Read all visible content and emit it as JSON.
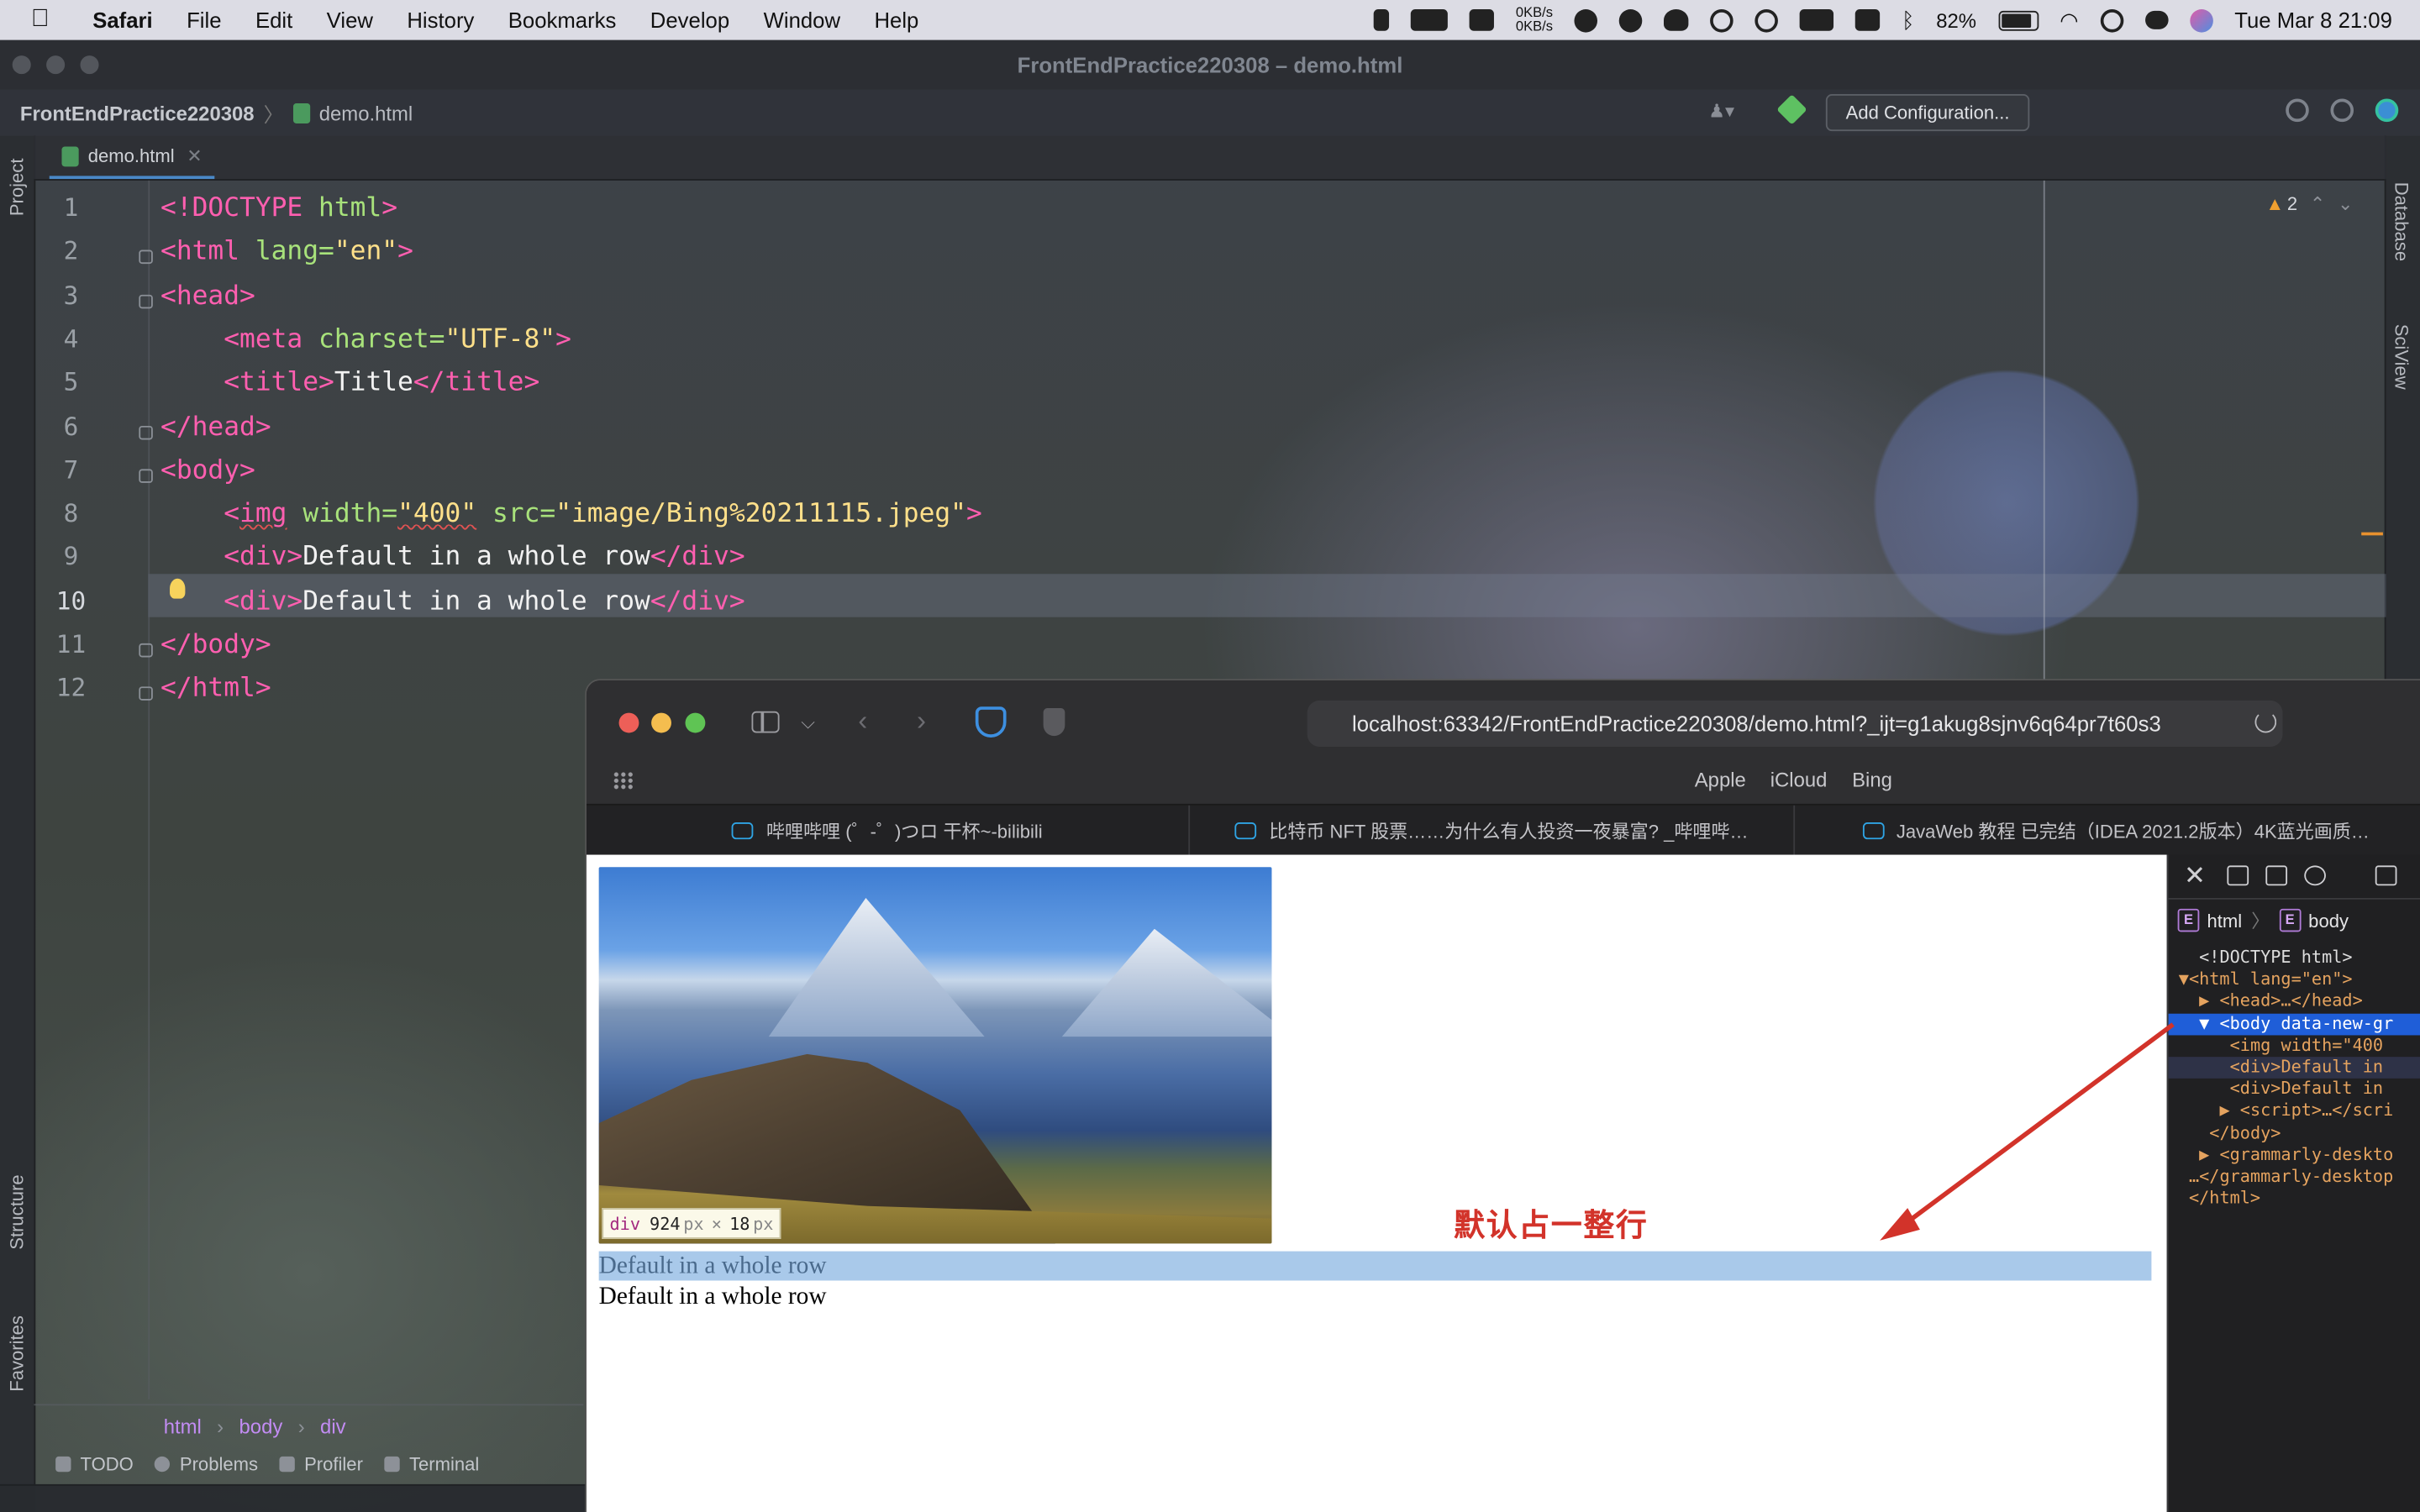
{
  "menubar": {
    "app": "Safari",
    "items": [
      "File",
      "Edit",
      "View",
      "History",
      "Bookmarks",
      "Develop",
      "Window",
      "Help"
    ],
    "net_up": "0KB/s",
    "net_down": "0KB/s",
    "battery_pct": "82%",
    "battery_level": 0.82,
    "datetime": "Tue Mar 8  21:09"
  },
  "ide": {
    "window_title": "FrontEndPractice220308 – demo.html",
    "project": "FrontEndPractice220308",
    "file": "demo.html",
    "add_config": "Add Configuration...",
    "tab": "demo.html",
    "left_tools": {
      "project": "Project",
      "structure": "Structure",
      "favorites": "Favorites"
    },
    "right_tools": {
      "database": "Database",
      "sciview": "SciView"
    },
    "warnings": "2",
    "current_line": 10,
    "lines": [
      {
        "n": "1",
        "tokens": [
          [
            "tg",
            "<!DOCTYPE "
          ],
          [
            "at",
            "html"
          ],
          [
            "tg",
            ">"
          ]
        ]
      },
      {
        "n": "2",
        "tokens": [
          [
            "tg",
            "<html "
          ],
          [
            "at",
            "lang="
          ],
          [
            "vl",
            "\"en\""
          ],
          [
            "tg",
            ">"
          ]
        ]
      },
      {
        "n": "3",
        "tokens": [
          [
            "tg",
            "<head>"
          ]
        ]
      },
      {
        "n": "4",
        "tokens": [
          [
            "tx",
            "    "
          ],
          [
            "tg",
            "<meta "
          ],
          [
            "at",
            "charset="
          ],
          [
            "vl",
            "\"UTF-8\""
          ],
          [
            "tg",
            ">"
          ]
        ]
      },
      {
        "n": "5",
        "tokens": [
          [
            "tx",
            "    "
          ],
          [
            "tg",
            "<title>"
          ],
          [
            "tx",
            "Title"
          ],
          [
            "tg",
            "</title>"
          ]
        ]
      },
      {
        "n": "6",
        "tokens": [
          [
            "tg",
            "</head>"
          ]
        ]
      },
      {
        "n": "7",
        "tokens": [
          [
            "tg",
            "<body>"
          ]
        ]
      },
      {
        "n": "8",
        "tokens": [
          [
            "tx",
            "    "
          ],
          [
            "tg",
            "<"
          ],
          [
            "tgsq",
            "img"
          ],
          [
            "tx",
            " "
          ],
          [
            "at",
            "width="
          ],
          [
            "vlsq",
            "\"400\""
          ],
          [
            "tx",
            " "
          ],
          [
            "at",
            "src="
          ],
          [
            "vl",
            "\"image/Bing%20211115.jpeg\""
          ],
          [
            "tg",
            ">"
          ]
        ]
      },
      {
        "n": "9",
        "tokens": [
          [
            "tx",
            "    "
          ],
          [
            "tg",
            "<div>"
          ],
          [
            "tx",
            "Default in a whole row"
          ],
          [
            "tg",
            "</div>"
          ]
        ]
      },
      {
        "n": "10",
        "tokens": [
          [
            "tx",
            "    "
          ],
          [
            "tg",
            "<div>"
          ],
          [
            "tx",
            "Default in a whole row"
          ],
          [
            "tg",
            "</div>"
          ]
        ]
      },
      {
        "n": "11",
        "tokens": [
          [
            "tg",
            "</body>"
          ]
        ]
      },
      {
        "n": "12",
        "tokens": [
          [
            "tg",
            "</html>"
          ]
        ]
      }
    ],
    "bottom_crumbs": [
      "html",
      "body",
      "div"
    ],
    "bottom_tools": [
      "TODO",
      "Problems",
      "Profiler",
      "Terminal"
    ]
  },
  "safari": {
    "url": "localhost:63342/FrontEndPractice220308/demo.html?_ijt=g1akug8sjnv6q64pr7t60s3",
    "favorites": [
      "Apple",
      "iCloud",
      "Bing"
    ],
    "tabs": [
      "哔哩哔哩 (゜-゜)つロ 干杯~-bilibili",
      "比特币 NFT 股票……为什么有人投资一夜暴富? _哔哩哔…",
      "JavaWeb 教程 已完结（IDEA 2021.2版本）4K蓝光画质…"
    ],
    "page": {
      "row1": "Default in a whole row",
      "row2": "Default in a whole row",
      "tooltip_tag": "div",
      "tooltip_w": "924",
      "tooltip_h": "18",
      "tooltip_unit": "px",
      "tooltip_x": "×",
      "annotation": "默认占一整行"
    },
    "devtools": {
      "crumbs": [
        "html",
        "body"
      ],
      "dom_lines": [
        {
          "t": "<!DOCTYPE html>",
          "cls": "dtx",
          "ind": "   "
        },
        {
          "t": "▼<html lang=\"en\">",
          "cls": "dt",
          "ind": " "
        },
        {
          "t": "▶ <head>…</head>",
          "cls": "dt",
          "ind": "   "
        },
        {
          "t": "▼ <body data-new-gr",
          "cls": "dtx",
          "ind": "   ",
          "sel": true
        },
        {
          "t": "<img width=\"400",
          "cls": "dt",
          "ind": "      "
        },
        {
          "t": "<div>Default in",
          "cls": "dt",
          "ind": "      ",
          "sub": true
        },
        {
          "t": "<div>Default in",
          "cls": "dt",
          "ind": "      "
        },
        {
          "t": "▶ <script>…</scri",
          "cls": "dt",
          "ind": "     "
        },
        {
          "t": "</body>",
          "cls": "dt",
          "ind": "    "
        },
        {
          "t": "▶ <grammarly-deskto",
          "cls": "dt",
          "ind": "   "
        },
        {
          "t": "…</grammarly-desktop",
          "cls": "dt",
          "ind": "  "
        },
        {
          "t": "</html>",
          "cls": "dt",
          "ind": "  "
        }
      ]
    }
  },
  "colors": {
    "accent": "#1f5ed8",
    "annotation": "#d2332a",
    "selection": "#a9c9ea"
  }
}
